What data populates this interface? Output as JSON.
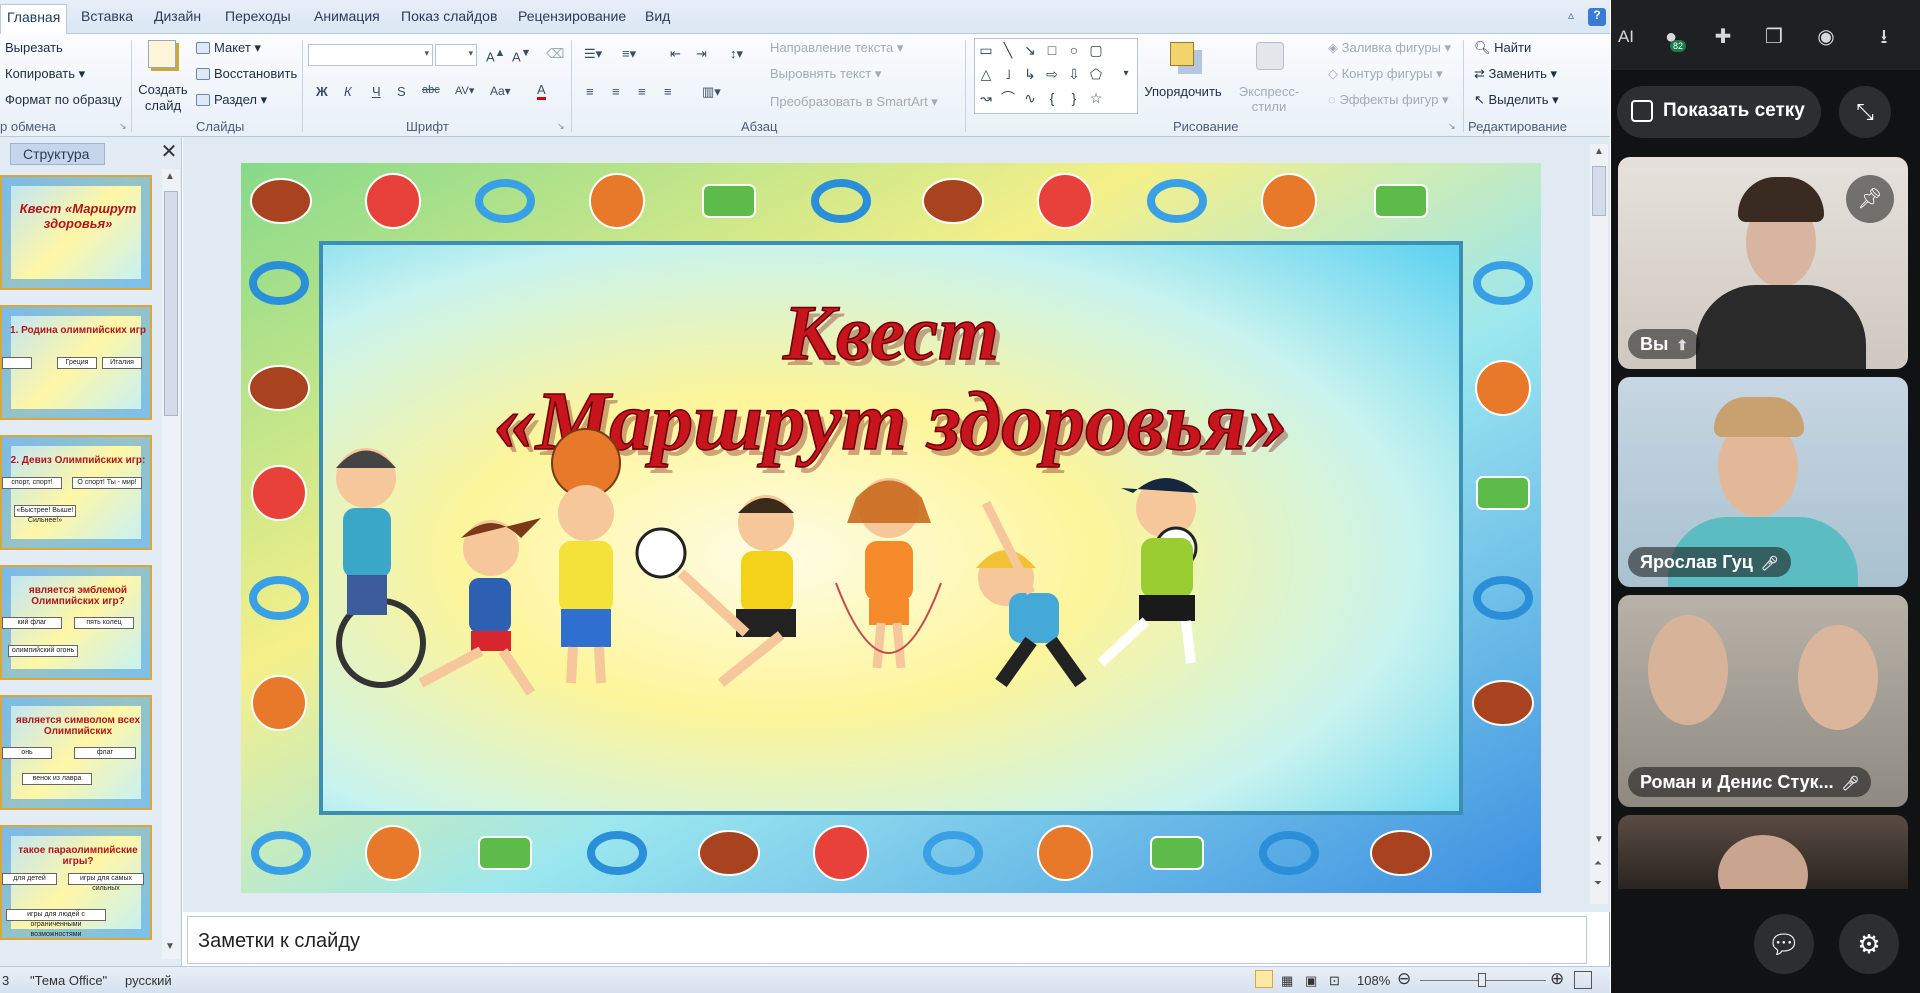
{
  "tabs": [
    "Главная",
    "Вставка",
    "Дизайн",
    "Переходы",
    "Анимация",
    "Показ слайдов",
    "Рецензирование",
    "Вид"
  ],
  "ribbon": {
    "clipboard": {
      "cut": "Вырезать",
      "copy": "Копировать",
      "format": "Формат по образцу",
      "label": "р обмена"
    },
    "slides": {
      "new_slide": "Создать слайд",
      "layout": "Макет",
      "reset": "Восстановить",
      "section": "Раздел",
      "label": "Слайды"
    },
    "font": {
      "label": "Шрифт"
    },
    "paragraph": {
      "text_direction": "Направление текста",
      "align_text": "Выровнять текст",
      "smartart": "Преобразовать в SmartArt",
      "label": "Абзац"
    },
    "drawing": {
      "arrange": "Упорядочить",
      "quick_styles": "Экспресс-стили",
      "fill": "Заливка фигуры",
      "outline": "Контур фигуры",
      "effects": "Эффекты фигур",
      "label": "Рисование"
    },
    "editing": {
      "find": "Найти",
      "replace": "Заменить",
      "select": "Выделить",
      "label": "Редактирование"
    }
  },
  "panel": {
    "tab": "Структура"
  },
  "thumbnails": [
    {
      "title": "Квест «Маршрут здоровья»",
      "options": []
    },
    {
      "title": "1. Родина олимпийских игр",
      "options": [
        "",
        "Греция",
        "Италия"
      ]
    },
    {
      "title": "2. Девиз Олимпийских игр:",
      "options": [
        "спорт, спорт!",
        "О спорт! Ты - мир!",
        "«Быстрее! Выше! Сильнее!»"
      ]
    },
    {
      "title": "является эмблемой Олимпийских игр?",
      "options": [
        "кий флаг",
        "пять колец",
        "олимпийский огонь"
      ]
    },
    {
      "title": "является символом всех Олимпийских",
      "options": [
        "онь",
        "флаг",
        "венок из лавра"
      ]
    },
    {
      "title": "такое параолимпийские игры?",
      "options": [
        "для детей",
        "игры для самых сильных",
        "игры для людей с ограниченными возможностями"
      ]
    }
  ],
  "slide": {
    "title_line1": "Квест",
    "title_line2": "«Маршрут здоровья»"
  },
  "notes_placeholder": "Заметки к слайду",
  "status": {
    "slide_no": "3",
    "theme": "\"Тема Office\"",
    "language": "русский",
    "zoom": "108%"
  },
  "call": {
    "show_grid": "Показать сетку",
    "extensions_badge": "82",
    "participants": [
      {
        "name": "Вы"
      },
      {
        "name": "Ярослав Гуц"
      },
      {
        "name": "Роман и Денис Стук..."
      }
    ]
  },
  "colors": {
    "accent_red": "#c8141c",
    "call_bg": "#101214"
  }
}
